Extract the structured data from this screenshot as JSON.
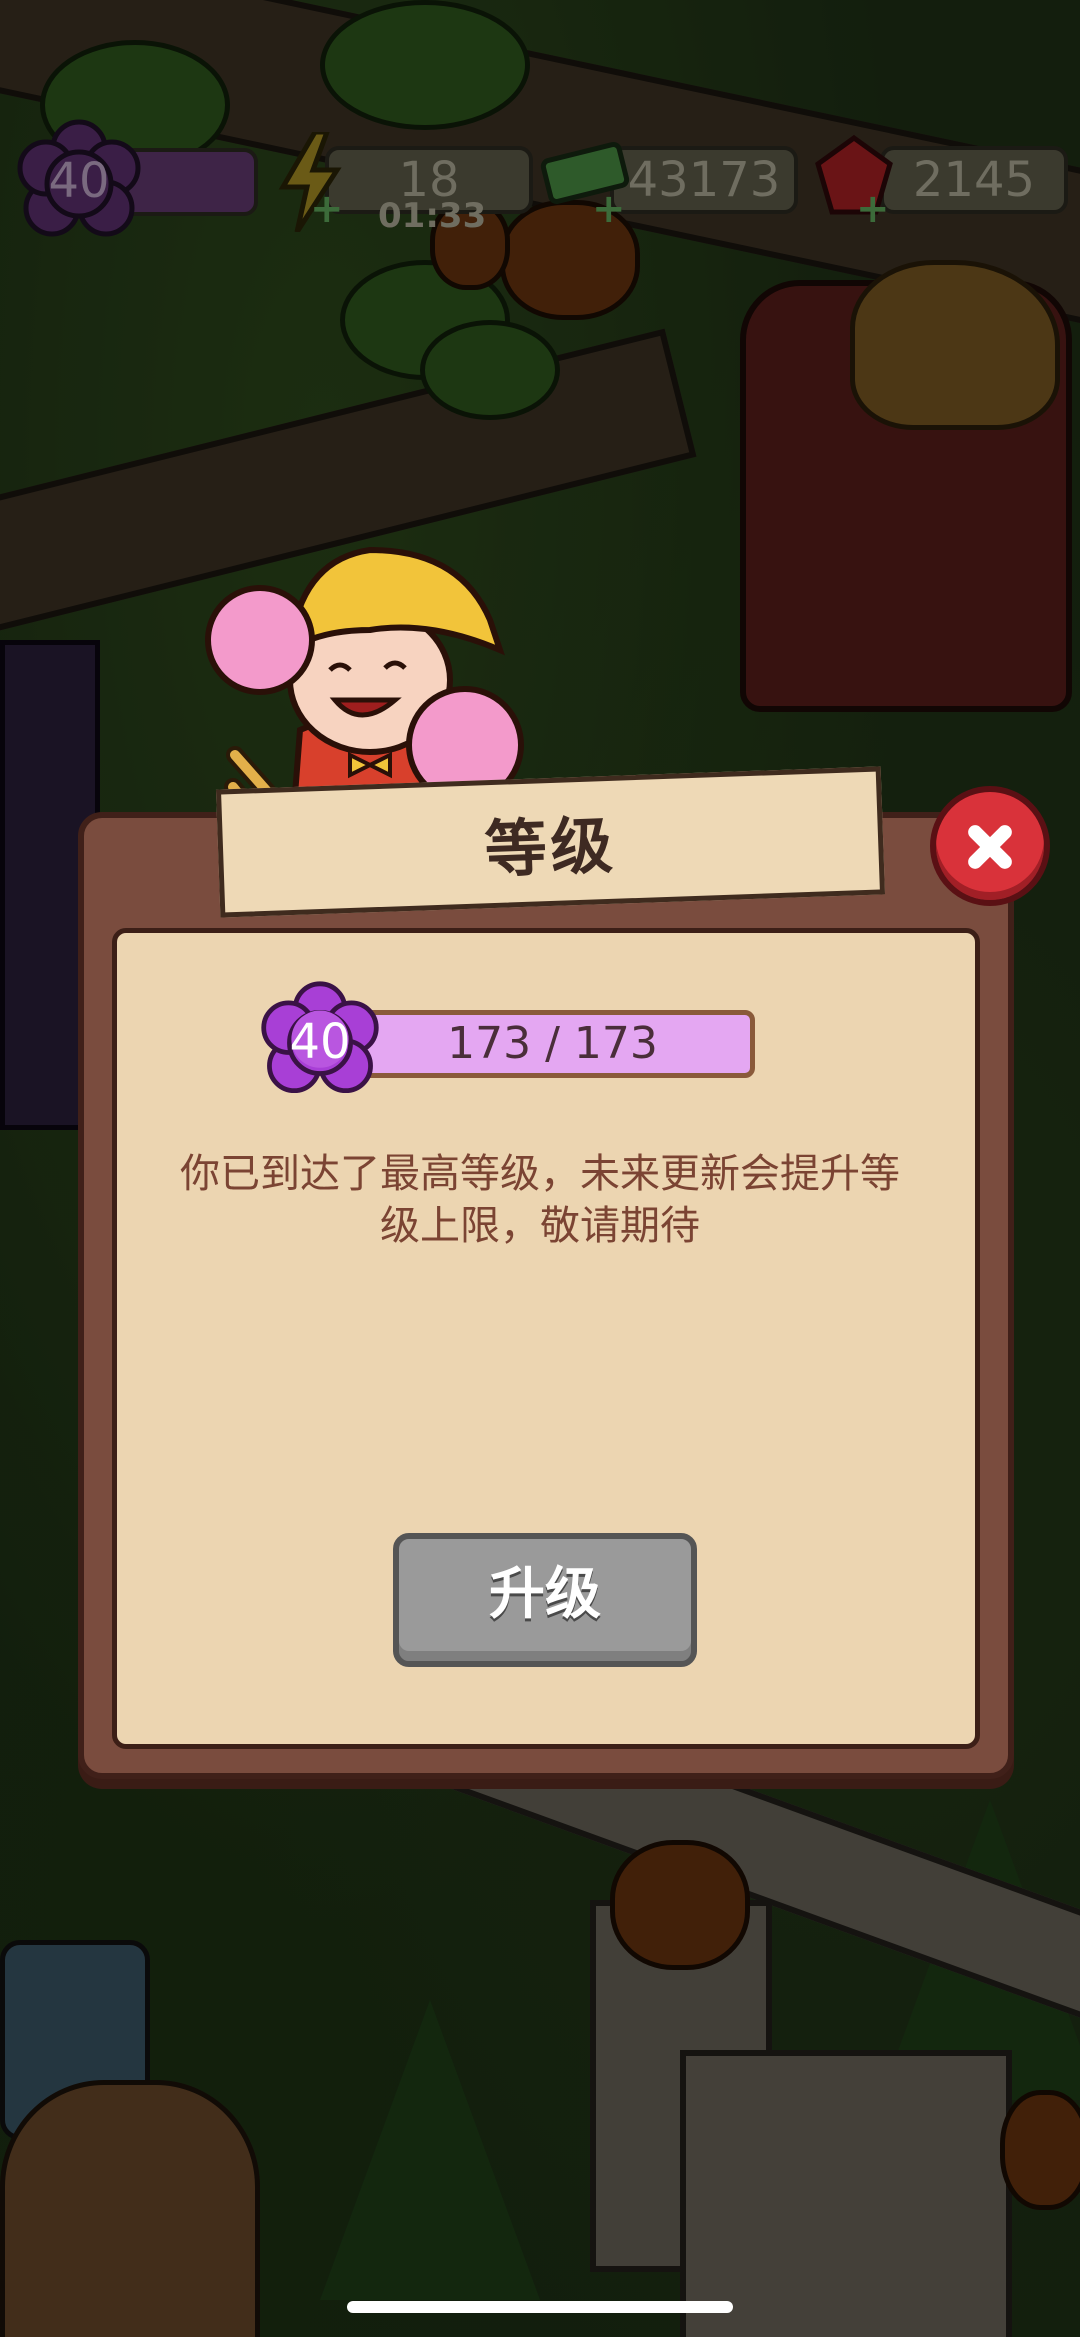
{
  "hud": {
    "level": "40",
    "energy": "18",
    "energy_timer": "01:33",
    "coins": "43173",
    "gems": "2145"
  },
  "dialog": {
    "title": "等级",
    "level": "40",
    "xp_text": "173 / 173",
    "xp_progress": 1.0,
    "message_line1": "你已到达了最高等级，未来更新会提升等",
    "message_line2": "级上限，敬请期待",
    "upgrade_label": "升级"
  },
  "colors": {
    "dialog_frame": "#7a4c3e",
    "dialog_panel": "#ecd5b1",
    "level_badge": "#a83fd6",
    "xp_bar": "#e4a7f2",
    "close_button": "#d9323a",
    "upgrade_button_disabled": "#9a9a9a"
  },
  "icons": {
    "hud_level": "purple-flower-badge-icon",
    "hud_energy": "lightning-icon",
    "hud_coins": "cash-icon",
    "hud_gems": "ruby-icon",
    "close": "close-x-icon",
    "dialog_level": "purple-flower-badge-icon"
  }
}
